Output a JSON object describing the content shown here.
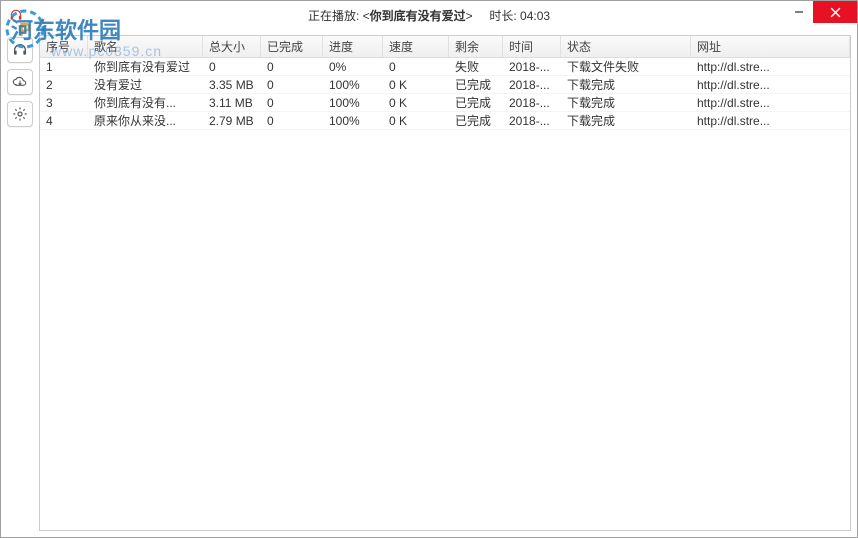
{
  "titlebar": {
    "playing_label": "正在播放: <",
    "track": "你到底有没有爱过",
    "suffix": ">",
    "duration_label": "时长: ",
    "duration": "04:03"
  },
  "watermark": {
    "text": "河东软件园",
    "url": "www.pc0359.cn"
  },
  "columns": {
    "idx": "序号",
    "name": "歌名",
    "size": "总大小",
    "done": "已完成",
    "prog": "进度",
    "speed": "速度",
    "remain": "剩余",
    "time": "时间",
    "status": "状态",
    "url": "网址"
  },
  "rows": [
    {
      "idx": "1",
      "name": "你到底有没有爱过",
      "size": "0",
      "done": "0",
      "prog": "0%",
      "speed": "0",
      "remain": "",
      "time": "失败",
      "t2": "2018-...",
      "status": "下载文件失败",
      "url": "http://dl.stre..."
    },
    {
      "idx": "2",
      "name": "没有爱过",
      "size": "3.35 MB",
      "done": "0",
      "prog": "100%",
      "speed": "0 K",
      "remain": "",
      "time": "已完成",
      "t2": "2018-...",
      "status": "下载完成",
      "url": "http://dl.stre..."
    },
    {
      "idx": "3",
      "name": "你到底有没有...",
      "size": "3.11 MB",
      "done": "0",
      "prog": "100%",
      "speed": "0 K",
      "remain": "",
      "time": "已完成",
      "t2": "2018-...",
      "status": "下载完成",
      "url": "http://dl.stre..."
    },
    {
      "idx": "4",
      "name": "原来你从来没...",
      "size": "2.79 MB",
      "done": "0",
      "prog": "100%",
      "speed": "0 K",
      "remain": "",
      "time": "已完成",
      "t2": "2018-...",
      "status": "下载完成",
      "url": "http://dl.stre..."
    }
  ]
}
